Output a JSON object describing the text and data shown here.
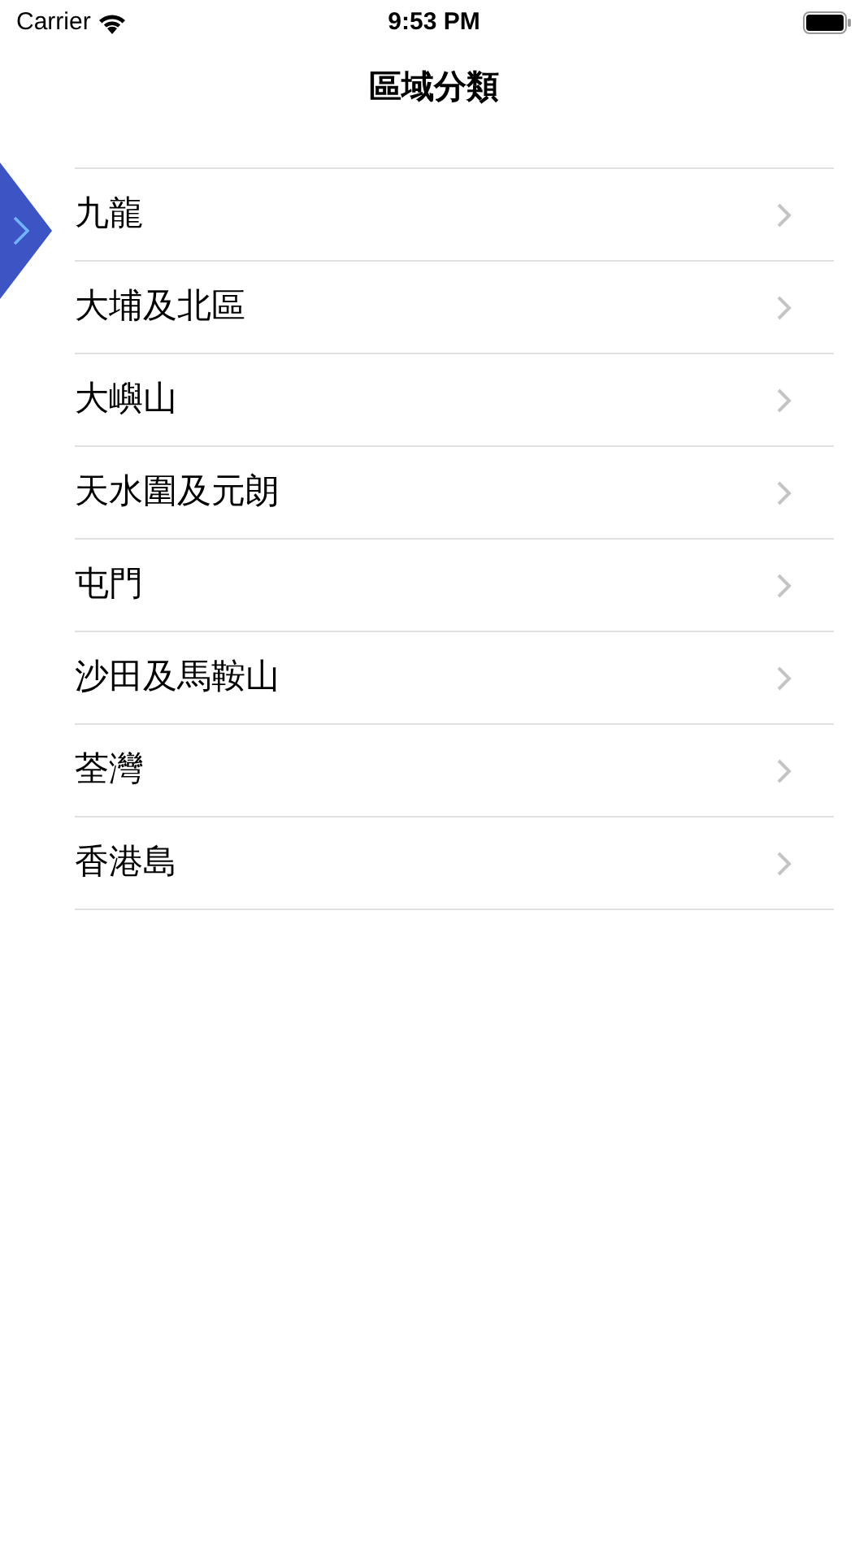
{
  "status_bar": {
    "carrier": "Carrier",
    "time": "9:53 PM"
  },
  "nav": {
    "title": "區域分類"
  },
  "regions": [
    {
      "label": "九龍"
    },
    {
      "label": "大埔及北區"
    },
    {
      "label": "大嶼山"
    },
    {
      "label": "天水圍及元朗"
    },
    {
      "label": "屯門"
    },
    {
      "label": "沙田及馬鞍山"
    },
    {
      "label": "荃灣"
    },
    {
      "label": "香港島"
    }
  ]
}
